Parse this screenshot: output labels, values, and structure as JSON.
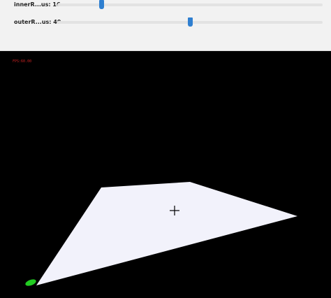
{
  "sliders": [
    {
      "label": "innerR...us:",
      "value": "16",
      "fraction": 0.167
    },
    {
      "label": "outerR...us:",
      "value": "49",
      "fraction": 0.5
    }
  ],
  "viewport": {
    "fps_text": "FPS:60.00",
    "background_color": "#000000",
    "plane_color": "#f2f2fb",
    "marker_color": "#22cc22",
    "crosshair_color": "#000000",
    "fps_color": "#cc2222"
  },
  "colors": {
    "panel_bg": "#f2f2f2",
    "slider_thumb": "#2f7fd0",
    "slider_track": "#e3e3e3"
  }
}
